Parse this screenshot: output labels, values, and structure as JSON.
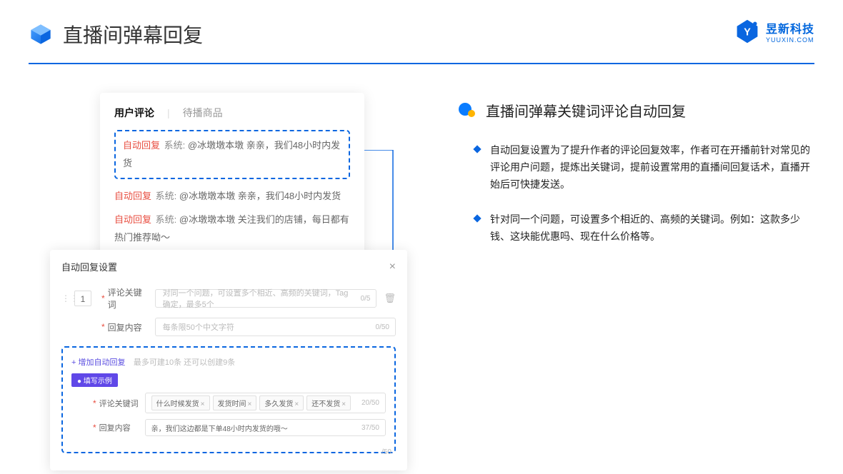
{
  "header": {
    "title": "直播间弹幕回复",
    "logo_main": "昱新科技",
    "logo_sub": "YUUXIN.COM"
  },
  "comments_card": {
    "tabs": {
      "active": "用户评论",
      "inactive": "待播商品"
    },
    "auto_tag": "自动回复",
    "sys_tag": "系统:",
    "highlighted": "@冰墩墩本墩 亲亲，我们48小时内发货",
    "line2": "@冰墩墩本墩 亲亲，我们48小时内发货",
    "line3": "@冰墩墩本墩 关注我们的店铺，每日都有热门推荐呦～"
  },
  "settings": {
    "title": "自动回复设置",
    "seq": "1",
    "row1_label": "评论关键词",
    "row1_placeholder": "对同一个问题，可设置多个相近、高频的关键词，Tag确定，最多5个",
    "row1_counter": "0/5",
    "row2_label": "回复内容",
    "row2_placeholder": "每条限50个中文字符",
    "row2_counter": "0/50",
    "add_link": "+ 增加自动回复",
    "add_hint": "最多可建10条 还可以创建9条",
    "example_badge": "● 填写示例",
    "ex_row1_label": "评论关键词",
    "ex_tags": [
      "什么时候发货",
      "发货时间",
      "多久发货",
      "还不发货"
    ],
    "ex_row1_counter": "20/50",
    "ex_row2_label": "回复内容",
    "ex_row2_value": "亲，我们这边都是下单48小时内发货的哦～",
    "ex_row2_counter": "37/50",
    "stray_counter": "/50"
  },
  "right": {
    "section_title": "直播间弹幕关键词评论自动回复",
    "bullets": [
      "自动回复设置为了提升作者的评论回复效率，作者可在开播前针对常见的评论用户问题，提炼出关键词，提前设置常用的直播间回复话术，直播开始后可快捷发送。",
      "针对同一个问题，可设置多个相近的、高频的关键词。例如：这款多少钱、这块能优惠吗、现在什么价格等。"
    ]
  }
}
